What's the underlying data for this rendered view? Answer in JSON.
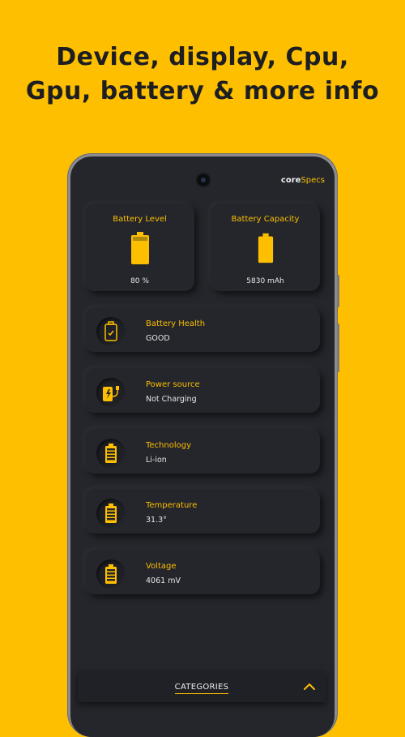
{
  "headline": {
    "line1": "Device, display, Cpu,",
    "line2": "Gpu, battery & more info"
  },
  "app": {
    "brand_part1": "core",
    "brand_part2": "Specs",
    "accent_color": "#FDBF00",
    "background_color": "#24262c"
  },
  "tiles": [
    {
      "title": "Battery Level",
      "value": "80 %"
    },
    {
      "title": "Battery Capacity",
      "value": "5830 mAh"
    }
  ],
  "rows": [
    {
      "label": "Battery Health",
      "value": "GOOD",
      "icon": "battery-health-icon"
    },
    {
      "label": "Power source",
      "value": "Not Charging",
      "icon": "power-source-icon"
    },
    {
      "label": "Technology",
      "value": "Li-ion",
      "icon": "battery-icon"
    },
    {
      "label": "Temperature",
      "value": "31.3°",
      "icon": "battery-icon"
    },
    {
      "label": "Voltage",
      "value": "4061 mV",
      "icon": "battery-icon"
    }
  ],
  "bottom_bar": {
    "label": "CATEGORIES",
    "icon": "chevron-up-icon"
  }
}
